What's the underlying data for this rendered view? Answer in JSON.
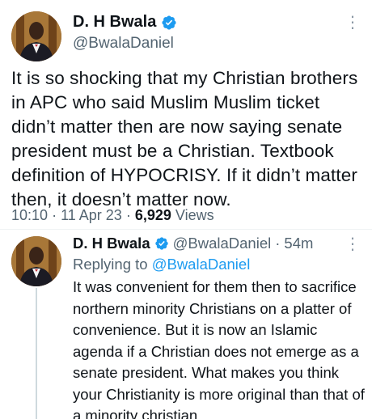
{
  "main_tweet": {
    "display_name": "D. H Bwala",
    "handle": "@BwalaDaniel",
    "text": "It is so shocking that my Christian brothers in APC who said Muslim Muslim ticket didn’t matter then are now saying senate president must be a Christian. Textbook definition of HYPOCRISY. If it didn’t matter then, it doesn’t matter now.",
    "time": "10:10",
    "date": "11 Apr 23",
    "views_count": "6,929",
    "views_label": "Views",
    "separator": "·"
  },
  "reply": {
    "display_name": "D. H Bwala",
    "handle": "@BwalaDaniel",
    "separator": "·",
    "age": "54m",
    "replying_prefix": "Replying to",
    "replying_mention": "@BwalaDaniel",
    "text": "It was convenient for them then to sacrifice northern minority Christians on a platter of convenience. But it is now an Islamic agenda if a Christian does not  emerge as a senate president. What makes you think your Christianity is more original than that of a  minority christian"
  },
  "icons": {
    "verified": "verified-badge-icon",
    "more": "more-options-icon"
  },
  "colors": {
    "accent": "#1d9bf0",
    "secondary_text": "#536471",
    "primary_text": "#0f1419"
  }
}
